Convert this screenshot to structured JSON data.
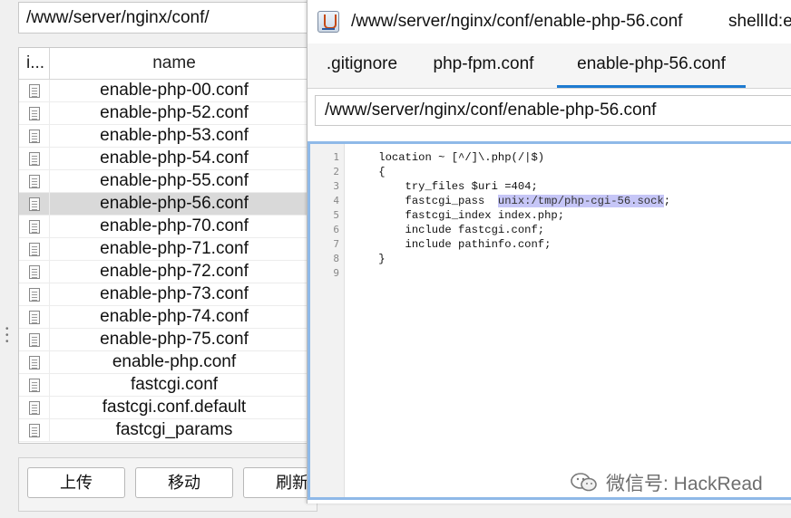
{
  "left": {
    "path": "/www/server/nginx/conf/",
    "columns": {
      "icon": "i...",
      "name": "name"
    },
    "files": [
      "enable-php-00.conf",
      "enable-php-52.conf",
      "enable-php-53.conf",
      "enable-php-54.conf",
      "enable-php-55.conf",
      "enable-php-56.conf",
      "enable-php-70.conf",
      "enable-php-71.conf",
      "enable-php-72.conf",
      "enable-php-73.conf",
      "enable-php-74.conf",
      "enable-php-75.conf",
      "enable-php.conf",
      "fastcgi.conf",
      "fastcgi.conf.default",
      "fastcgi_params"
    ],
    "selected_file": "enable-php-56.conf",
    "buttons": {
      "upload": "上传",
      "move": "移动",
      "refresh": "刷新"
    }
  },
  "editor": {
    "title": "/www/server/nginx/conf/enable-php-56.conf",
    "title_extra": "shellId:e",
    "tabs": [
      {
        "label": ".gitignore",
        "active": false
      },
      {
        "label": "php-fpm.conf",
        "active": false
      },
      {
        "label": "enable-php-56.conf",
        "active": true
      }
    ],
    "path": "/www/server/nginx/conf/enable-php-56.conf",
    "line_numbers": [
      "1",
      "2",
      "3",
      "4",
      "5",
      "6",
      "7",
      "8",
      "9"
    ],
    "code": [
      "    location ~ [^/]\\.php(/|$)",
      "    {",
      "        try_files $uri =404;",
      "        fastcgi_pass  ",
      "        fastcgi_index index.php;",
      "        include fastcgi.conf;",
      "        include pathinfo.conf;",
      "    }",
      ""
    ],
    "highlight": "unix:/tmp/php-cgi-56.sock",
    "highlight_suffix": ";"
  },
  "watermark": "微信号: HackRead",
  "colors": {
    "tab_underline": "#1e7bd0",
    "editor_border": "#8fb9e8",
    "selection": "#c6c6f7",
    "selected_row": "#d9d9d9"
  },
  "icons": {
    "file": "file-icon",
    "app": "app-icon",
    "wechat": "wechat-icon"
  }
}
